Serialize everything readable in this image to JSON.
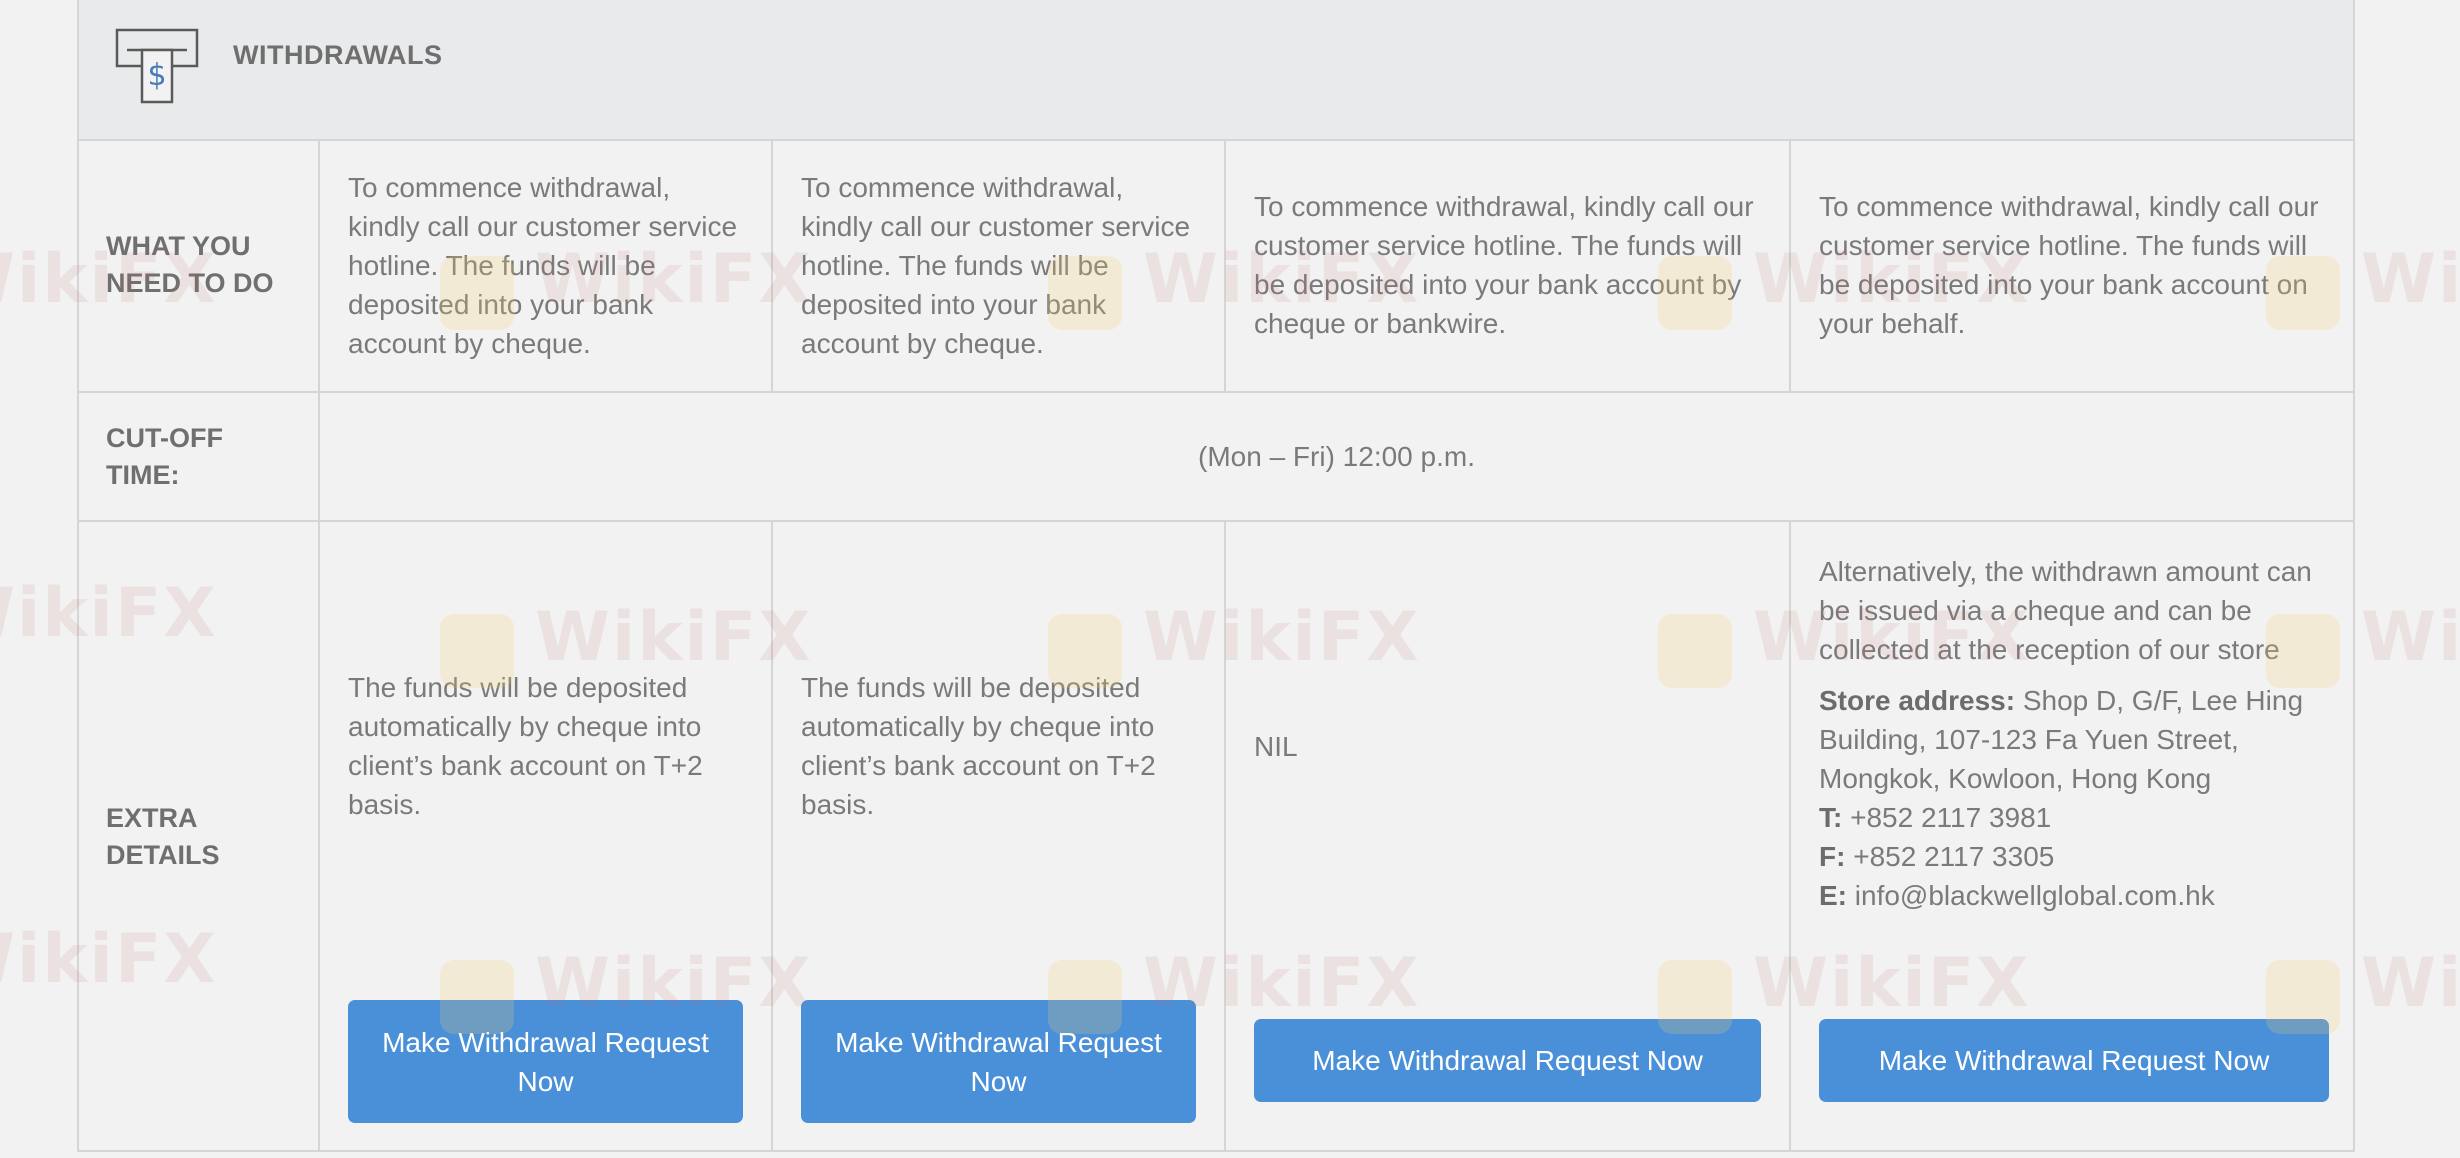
{
  "header": {
    "title": "WITHDRAWALS",
    "icon": "atm-dollar-icon"
  },
  "rows": {
    "what_you_need": {
      "label": "WHAT YOU NEED TO DO",
      "cells": [
        "To commence withdrawal, kindly call our customer service hotline. The funds will be deposited into your bank account by cheque.",
        "To commence withdrawal, kindly call our customer service hotline. The funds will be deposited into your bank account by cheque.",
        "To commence withdrawal, kindly call our customer service hotline. The funds will be deposited into your bank account by cheque or bankwire.",
        "To commence withdrawal, kindly call our customer service hotline. The funds will be deposited into your bank account on your behalf."
      ]
    },
    "cutoff": {
      "label": "CUT-OFF TIME:",
      "value": "(Mon – Fri) 12:00 p.m."
    },
    "extra": {
      "label": "EXTRA DETAILS",
      "cells": [
        "The funds will be deposited automatically by cheque into client’s bank account on T+2 basis.",
        "The funds will be deposited automatically by cheque into client’s bank account on T+2 basis.",
        "NIL"
      ],
      "store": {
        "intro": "Alternatively, the withdrawn amount can be issued via a cheque and can be collected at the reception of our store",
        "address_label": "Store address:",
        "address": "Shop D, G/F, Lee Hing Building, 107-123 Fa Yuen Street, Mongkok, Kowloon, Hong Kong",
        "tel_label": "T:",
        "tel": "+852 2117 3981",
        "fax_label": "F:",
        "fax": "+852 2117 3305",
        "email_label": "E:",
        "email": "info@blackwellglobal.com.hk"
      }
    }
  },
  "buttons": {
    "withdraw_label": "Make Withdrawal Request Now"
  },
  "watermark": {
    "text": "WikiFX"
  },
  "colors": {
    "button": "#4a90d9",
    "header_bg": "#e9eaeb",
    "page_bg": "#f2f2f2",
    "border": "#d5d5d5"
  }
}
